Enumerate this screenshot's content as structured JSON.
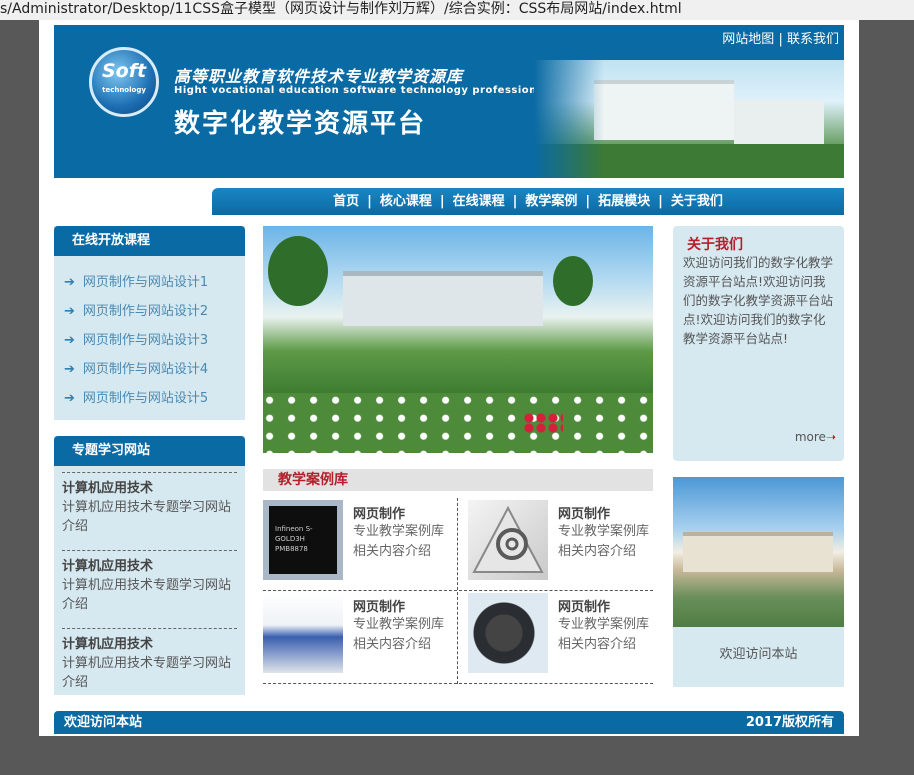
{
  "browser": {
    "url": "s/Administrator/Desktop/11CSS盒子模型（网页设计与制作刘万辉）/综合实例：CSS布局网站/index.html"
  },
  "header": {
    "toplinks": [
      "网站地图",
      "联系我们"
    ],
    "toplinks_sep": "|",
    "logo_text": "Soft",
    "logo_sub": "technology",
    "title_cn": "高等职业教育软件技术专业教学资源库",
    "title_en": "Hight vocational education software technology professional teaching",
    "main_title": "数字化教学资源平台"
  },
  "nav": {
    "items": [
      "首页",
      "核心课程",
      "在线课程",
      "教学案例",
      "拓展模块",
      "关于我们"
    ],
    "sep": "|"
  },
  "courses": {
    "title": "在线开放课程",
    "arrow": "➔",
    "items": [
      "网页制作与网站设计1",
      "网页制作与网站设计2",
      "网页制作与网站设计3",
      "网页制作与网站设计4",
      "网页制作与网站设计5"
    ]
  },
  "topics": {
    "title": "专题学习网站",
    "items": [
      {
        "title": "计算机应用技术",
        "desc": "计算机应用技术专题学习网站介绍"
      },
      {
        "title": "计算机应用技术",
        "desc": "计算机应用技术专题学习网站介绍"
      },
      {
        "title": "计算机应用技术",
        "desc": "计算机应用技术专题学习网站介绍"
      }
    ]
  },
  "cases": {
    "title": "教学案例库",
    "items": [
      {
        "name": "网页制作",
        "desc": "专业教学案例库相关内容介绍",
        "icon": "chip-image"
      },
      {
        "name": "网页制作",
        "desc": "专业教学案例库相关内容介绍",
        "icon": "at-sign-image"
      },
      {
        "name": "网页制作",
        "desc": "专业教学案例库相关内容介绍",
        "icon": "machine-image"
      },
      {
        "name": "网页制作",
        "desc": "专业教学案例库相关内容介绍",
        "icon": "motor-image"
      }
    ],
    "chip_label": "Infineon S-GOLD3H PMB8878"
  },
  "about": {
    "title": "关于我们",
    "text": "欢迎访问我们的数字化教学资源平台站点!欢迎访问我们的数字化教学资源平台站点!欢迎访问我们的数字化教学资源平台站点!",
    "more": "more",
    "more_arrow": "➝"
  },
  "welcome": {
    "caption": "欢迎访问本站"
  },
  "footer": {
    "left": "欢迎访问本站",
    "right": "2017版权所有"
  },
  "colors": {
    "primary": "#0a6aa3",
    "panel": "#d6e8f0",
    "accent_red": "#b3202b"
  }
}
